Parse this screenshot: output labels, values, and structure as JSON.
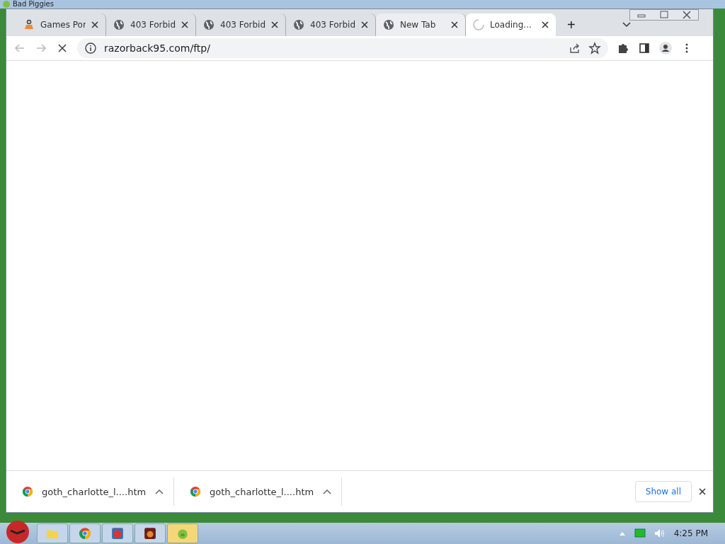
{
  "outer_window": {
    "title": "Bad Piggies"
  },
  "tabs": [
    {
      "label": "Games Por",
      "kind": "game",
      "selected": false,
      "hovered": false
    },
    {
      "label": "403 Forbid",
      "kind": "globe",
      "selected": false,
      "hovered": false
    },
    {
      "label": "403 Forbid",
      "kind": "globe",
      "selected": false,
      "hovered": false
    },
    {
      "label": "403 Forbid",
      "kind": "globe",
      "selected": false,
      "hovered": false
    },
    {
      "label": "New Tab",
      "kind": "globe",
      "selected": false,
      "hovered": true
    },
    {
      "label": "Loading...",
      "kind": "spinner",
      "selected": true,
      "hovered": false
    }
  ],
  "new_tab_button": "+",
  "address_bar": {
    "url": "razorback95.com/ftp/"
  },
  "downloads": [
    {
      "filename": "goth_charlotte_l....htm"
    },
    {
      "filename": "goth_charlotte_l....htm"
    }
  ],
  "show_all_button": "Show all",
  "taskbar": {
    "apps": [
      {
        "kind": "folder",
        "active": false
      },
      {
        "kind": "chrome",
        "active": false
      },
      {
        "kind": "bird",
        "active": false
      },
      {
        "kind": "game",
        "active": false
      },
      {
        "kind": "pig",
        "active": true
      }
    ],
    "clock": "4:25 PM"
  }
}
